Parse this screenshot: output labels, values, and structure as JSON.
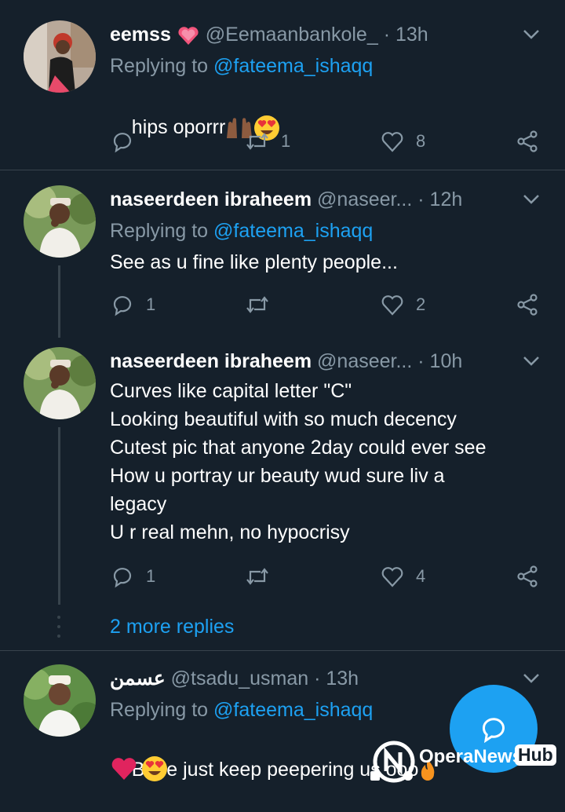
{
  "tweets": [
    {
      "name": "eemss",
      "handle": "@Eemaanbankole_",
      "time": "· 13h",
      "replying_prefix": "Replying to ",
      "replying_to": "@fateema_ishaqq",
      "text": "hips oporrr",
      "retweets": "1",
      "likes": "8"
    },
    {
      "name": "naseerdeen ibraheem",
      "handle": "@naseer...",
      "time": "· 12h",
      "replying_prefix": "Replying to ",
      "replying_to": "@fateema_ishaqq",
      "text": "See as u fine like plenty people...",
      "replies": "1",
      "likes": "2"
    },
    {
      "name": "naseerdeen ibraheem",
      "handle": "@naseer...",
      "time": "· 10h",
      "text": "Curves like capital letter \"C\"\nLooking beautiful with so much decency\nCutest pic that anyone 2day could ever see\nHow u portray ur beauty wud sure liv a\nlegacy\nU r real mehn, no hypocrisy",
      "replies": "1",
      "likes": "4"
    },
    {
      "name": "عسمن",
      "handle": "@tsadu_usman",
      "time": "· 13h",
      "replying_prefix": "Replying to ",
      "replying_to": "@fateema_ishaqq",
      "text": "Babe just keep peepering us ooo"
    }
  ],
  "more_replies": "2 more replies",
  "watermark": {
    "brand": "OperaNews",
    "hub": "Hub"
  },
  "colors": {
    "background": "#15202b",
    "accent": "#1da1f2",
    "muted": "#8899a6",
    "divider": "#38444d"
  }
}
